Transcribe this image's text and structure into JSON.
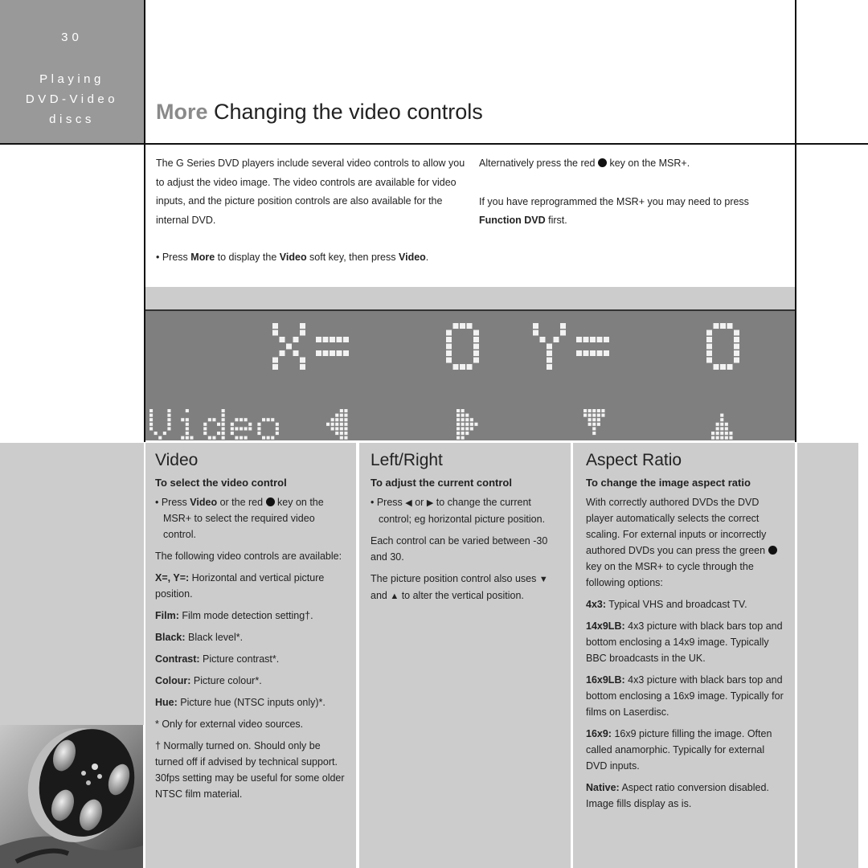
{
  "sidebar": {
    "page_number": "30",
    "section_lines": [
      "Playing",
      "DVD-Video",
      "discs"
    ],
    "color": "#999999"
  },
  "header": {
    "title_prefix": "More",
    "title_main": "Changing the video controls"
  },
  "intro": {
    "left_paragraph": "The G Series DVD players include several video controls to allow you to adjust the video image. The video controls are available for video inputs, and the picture position controls are also available for the internal DVD.",
    "bullet": {
      "prefix": "• Press ",
      "b1": "More",
      "mid1": " to display the ",
      "b2": "Video",
      "mid2": " soft key, then press ",
      "b3": "Video",
      "suffix": "."
    },
    "right_p1_before": "Alternatively press the red ",
    "right_p1_after": " key on the MSR+.",
    "right_p2": "If you have reprogrammed the MSR+ you may need to press",
    "right_p2_bold": "Function DVD",
    "right_p2_after": " first."
  },
  "lcd_display": {
    "line1": "X=  0 Y=  0",
    "line2_label": "Video",
    "soft_keys": [
      "left-arrow",
      "right-arrow",
      "down-arrow",
      "up-arrow"
    ],
    "background": "#7f7f7f"
  },
  "columns": [
    {
      "heading": "Video",
      "subheading": "To select the video control",
      "bullet_prefix": "• Press ",
      "bullet_bold": "Video",
      "bullet_mid": " or the red ",
      "bullet_after": " key on the MSR+ to select the required video control.",
      "available": "The following video controls are available:",
      "items": [
        {
          "term": "X=, Y=:",
          "desc": " Horizontal and vertical picture position."
        },
        {
          "term": "Film:",
          "desc": " Film mode detection setting†."
        },
        {
          "term": "Black:",
          "desc": " Black level*."
        },
        {
          "term": "Contrast:",
          "desc": " Picture contrast*."
        },
        {
          "term": "Colour:",
          "desc": " Picture colour*."
        },
        {
          "term": "Hue:",
          "desc": " Picture hue (NTSC inputs only)*."
        }
      ],
      "footnote_star": "* Only for external video sources.",
      "footnote_dagger": "† Normally turned on. Should only be turned off if advised by technical support. 30fps setting may be useful for some older NTSC film material."
    },
    {
      "heading": "Left/Right",
      "subheading": "To adjust the current control",
      "bullet_prefix": "• Press ",
      "bullet_mid": " or ",
      "bullet_after": " to change the current control; eg horizontal picture position.",
      "range_text": "Each control can be varied between -30 and 30.",
      "pos_before": "The picture position control also uses ",
      "pos_mid": " and ",
      "pos_after": " to alter the vertical position."
    },
    {
      "heading": "Aspect Ratio",
      "subheading": "To change the image aspect ratio",
      "intro_before": "With correctly authored DVDs the DVD player automatically selects the correct scaling. For external inputs or incorrectly authored DVDs you can press the green ",
      "intro_after": " key on the MSR+ to cycle through the following options:",
      "items": [
        {
          "term": "4x3:",
          "desc": " Typical VHS and broadcast TV."
        },
        {
          "term": "14x9LB:",
          "desc": " 4x3 picture with black bars top and bottom enclosing a 14x9 image. Typically BBC broadcasts in the UK."
        },
        {
          "term": "16x9LB:",
          "desc": " 4x3 picture with black bars top and bottom enclosing a 16x9 image. Typically for films on Laserdisc."
        },
        {
          "term": "16x9:",
          "desc": " 16x9 picture filling the image. Often called anamorphic. Typically for external DVD inputs."
        },
        {
          "term": "Native:",
          "desc": " Aspect ratio conversion disabled. Image fills display as is."
        }
      ]
    }
  ],
  "icons": {
    "left_triangle": "◀",
    "right_triangle": "▶",
    "down_triangle": "▼",
    "up_triangle": "▲"
  },
  "photo": {
    "subject": "film-reel"
  }
}
